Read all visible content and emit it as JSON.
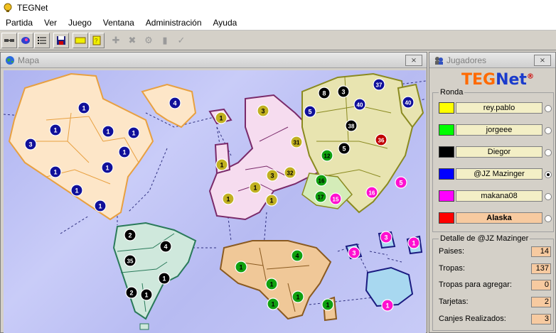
{
  "app": {
    "title": "TEGNet"
  },
  "menu": [
    "Partida",
    "Ver",
    "Juego",
    "Ventana",
    "Administración",
    "Ayuda"
  ],
  "map_window": {
    "title": "Mapa",
    "close": "⨯"
  },
  "players_window": {
    "title": "Jugadores",
    "close": "⨯",
    "logo_a": "TEG",
    "logo_b": "Net",
    "logo_reg": "®",
    "round_label": "Ronda",
    "players": [
      {
        "name": "rey.pablo",
        "color": "#ffff00",
        "name_bold": false,
        "selected": false
      },
      {
        "name": "jorgeee",
        "color": "#00ff00",
        "name_bold": false,
        "selected": false
      },
      {
        "name": "Diegor",
        "color": "#000000",
        "name_bold": false,
        "selected": false
      },
      {
        "name": "@JZ Mazinger",
        "color": "#0000ff",
        "name_bold": false,
        "selected": true
      },
      {
        "name": "makana08",
        "color": "#ff00ff",
        "name_bold": false,
        "selected": false
      },
      {
        "name": "Alaska",
        "color": "#ff0000",
        "name_bold": true,
        "selected": false
      }
    ],
    "detail_label": "Detalle de @JZ Mazinger",
    "details": [
      {
        "label": "Paises:",
        "value": "14"
      },
      {
        "label": "Tropas:",
        "value": "137"
      },
      {
        "label": "Tropas para agregar:",
        "value": "0"
      },
      {
        "label": "Tarjetas:",
        "value": "2"
      },
      {
        "label": "Canjes Realizados:",
        "value": "3"
      }
    ]
  },
  "map": {
    "armies": [
      {
        "n": "1",
        "c": "blue"
      },
      {
        "n": "4",
        "c": "blue"
      },
      {
        "n": "1",
        "c": "blue"
      },
      {
        "n": "3",
        "c": "blue"
      },
      {
        "n": "1",
        "c": "blue"
      },
      {
        "n": "1",
        "c": "blue"
      },
      {
        "n": "1",
        "c": "blue"
      },
      {
        "n": "1",
        "c": "blue"
      },
      {
        "n": "1",
        "c": "blue"
      },
      {
        "n": "1",
        "c": "blue"
      },
      {
        "n": "1",
        "c": "blue"
      },
      {
        "n": "2",
        "c": "black"
      },
      {
        "n": "4",
        "c": "black"
      },
      {
        "n": "35",
        "c": "black"
      },
      {
        "n": "1",
        "c": "black"
      },
      {
        "n": "2",
        "c": "black"
      },
      {
        "n": "1",
        "c": "black"
      },
      {
        "n": "1",
        "c": "yellow"
      },
      {
        "n": "3",
        "c": "yellow"
      },
      {
        "n": "31",
        "c": "yellow"
      },
      {
        "n": "1",
        "c": "yellow"
      },
      {
        "n": "3",
        "c": "yellow"
      },
      {
        "n": "32",
        "c": "yellow"
      },
      {
        "n": "1",
        "c": "yellow"
      },
      {
        "n": "1",
        "c": "yellow"
      },
      {
        "n": "1",
        "c": "yellow"
      },
      {
        "n": "8",
        "c": "black"
      },
      {
        "n": "3",
        "c": "black"
      },
      {
        "n": "37",
        "c": "blue"
      },
      {
        "n": "5",
        "c": "blue"
      },
      {
        "n": "40",
        "c": "blue"
      },
      {
        "n": "40",
        "c": "blue"
      },
      {
        "n": "38",
        "c": "black"
      },
      {
        "n": "36",
        "c": "red"
      },
      {
        "n": "5",
        "c": "black"
      },
      {
        "n": "12",
        "c": "green"
      },
      {
        "n": "16",
        "c": "green"
      },
      {
        "n": "17",
        "c": "green"
      },
      {
        "n": "15",
        "c": "magenta"
      },
      {
        "n": "16",
        "c": "magenta"
      },
      {
        "n": "5",
        "c": "magenta"
      },
      {
        "n": "4",
        "c": "green"
      },
      {
        "n": "1",
        "c": "green"
      },
      {
        "n": "1",
        "c": "green"
      },
      {
        "n": "1",
        "c": "green"
      },
      {
        "n": "1",
        "c": "green"
      },
      {
        "n": "1",
        "c": "green"
      },
      {
        "n": "3",
        "c": "magenta"
      },
      {
        "n": "3",
        "c": "magenta"
      },
      {
        "n": "1",
        "c": "magenta"
      },
      {
        "n": "1",
        "c": "magenta"
      }
    ]
  }
}
